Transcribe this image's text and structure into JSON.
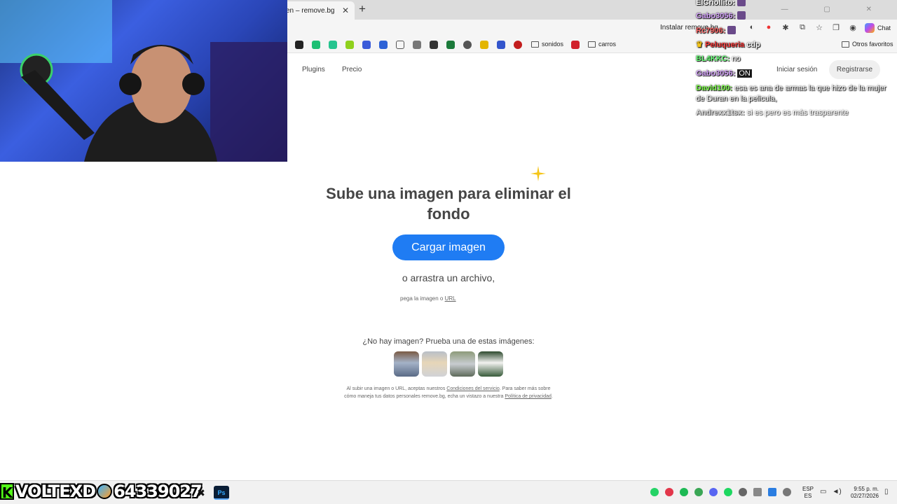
{
  "browser": {
    "tab_title": "en – remove.bg",
    "tab_close": "✕",
    "new_tab": "+",
    "window_controls": "— ▢ ✕",
    "install_app": "Instalar remove.bg",
    "copilot_label": "Chat",
    "bookmark_folders": [
      "sonidos",
      "carros"
    ],
    "other_favorites": "Otros favoritos"
  },
  "site": {
    "nav": {
      "plugins": "Plugins",
      "pricing": "Precio",
      "login": "Iniciar sesión",
      "signup": "Registrarse"
    },
    "headline": "Sube una imagen para eliminar el fondo",
    "upload_button": "Cargar imagen",
    "drag_text": "o arrastra un archivo,",
    "paste_prefix": "pega la imagen o ",
    "paste_url": "URL",
    "samples_title": "¿No hay imagen? Prueba una de estas imágenes:",
    "legal": {
      "part1": "Al subir una imagen o URL, aceptas nuestros ",
      "terms": "Condiciones del servicio",
      "part2": ". Para saber más sobre cómo maneja tus datos personales remove.bg, echa un vistazo a nuestra ",
      "privacy": "Política de privacidad",
      "part3": "."
    },
    "accent_color": "#1f7cf3"
  },
  "chat": [
    {
      "user": "ElCriollito:",
      "message": "",
      "color": "#ffffff"
    },
    {
      "user": "Gabo3056:",
      "message": "",
      "color": "#d9a7ff"
    },
    {
      "user": "Rc7906:",
      "message": "",
      "color": "#ff6b6b"
    },
    {
      "user": "Peluqueria",
      "message": "cdp",
      "color": "#ff4040"
    },
    {
      "user": "BL4KKC:",
      "message": "no",
      "color": "#6bff7a"
    },
    {
      "user": "Gabo3056:",
      "message": "ON",
      "color": "#d9a7ff"
    },
    {
      "user": "David100:",
      "message": "esa es ana de armas la que hizo de la mujer de Duran en la pelicula,",
      "color": "#7dff4a"
    },
    {
      "user": "Andrexx1tsx:",
      "message": "si es pero es más trasparente",
      "color": "#cccccc"
    }
  ],
  "stream": {
    "channel": "VOLTEXD",
    "points": "64339027",
    "k_logo": "K"
  },
  "taskbar": {
    "photoshop": "Ps",
    "lang_line1": "ESP",
    "lang_line2": "ES",
    "time": "9:55 p. m.",
    "date": "02/27/2026"
  }
}
